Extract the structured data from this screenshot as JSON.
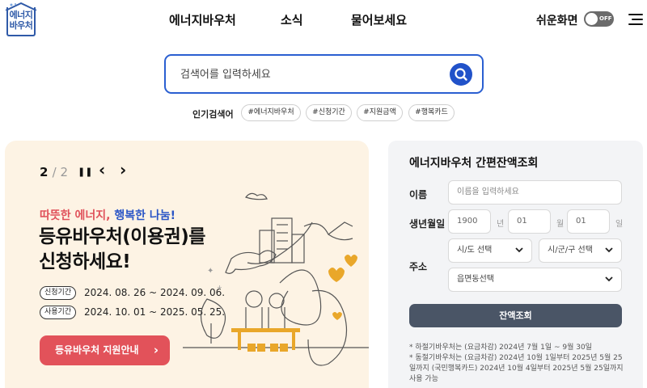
{
  "logo": {
    "text": "에너지바우처"
  },
  "nav": {
    "items": [
      "에너지바우처",
      "소식",
      "물어보세요"
    ]
  },
  "easy_mode": {
    "label": "쉬운화면",
    "state": "OFF"
  },
  "search": {
    "placeholder": "검색어를 입력하세요"
  },
  "popular": {
    "label": "인기검색어",
    "tags": [
      "#에너지바우처",
      "#신청기간",
      "#지원금액",
      "#행복카드"
    ]
  },
  "banner": {
    "pager": {
      "current": "2",
      "total": "2"
    },
    "controls": {
      "pause": "❚❚",
      "prev": "‹",
      "next": "›"
    },
    "kicker_red": "따뜻한 에너지,",
    "kicker_blue": "행복한 나눔!",
    "headline_line1": "등유바우처(이용권)를",
    "headline_line2": "신청하세요!",
    "apply_period_label": "신청기간",
    "apply_period": "2024. 08. 26 ~ 2024. 09. 06.",
    "use_period_label": "사용기간",
    "use_period": "2024. 10. 01 ~ 2025. 05. 25.",
    "cta_label": "등유바우처 지원안내",
    "cta_arrow": "›"
  },
  "balance": {
    "title": "에너지바우처 간편잔액조회",
    "name_label": "이름",
    "name_placeholder": "이름을 입력하세요",
    "birth_label": "생년월일",
    "birth_year": "1900",
    "birth_year_unit": "년",
    "birth_month": "01",
    "birth_month_unit": "월",
    "birth_day": "01",
    "birth_day_unit": "일",
    "address_label": "주소",
    "sido_select": "시/도 선택",
    "sigungu_select": "시/군/구 선택",
    "dong_select": "읍면동선택",
    "submit_label": "잔액조회",
    "notes": [
      "* 하절기바우처는 (요금차감) 2024년 7월 1일 ~ 9월 30일",
      "* 동절기바우처는 (요금차감) 2024년 10월 1일부터 2025년 5월 25일까지 (국민행복카드) 2024년 10월 4일부터 2025년 5월 25일까지 사용 가능"
    ]
  },
  "colors": {
    "primary_blue": "#2152c9",
    "banner_bg": "#fdf3e4",
    "cta_red": "#e2525a",
    "panel_bg": "#f3f4f6",
    "submit_bg": "#4a5566"
  }
}
